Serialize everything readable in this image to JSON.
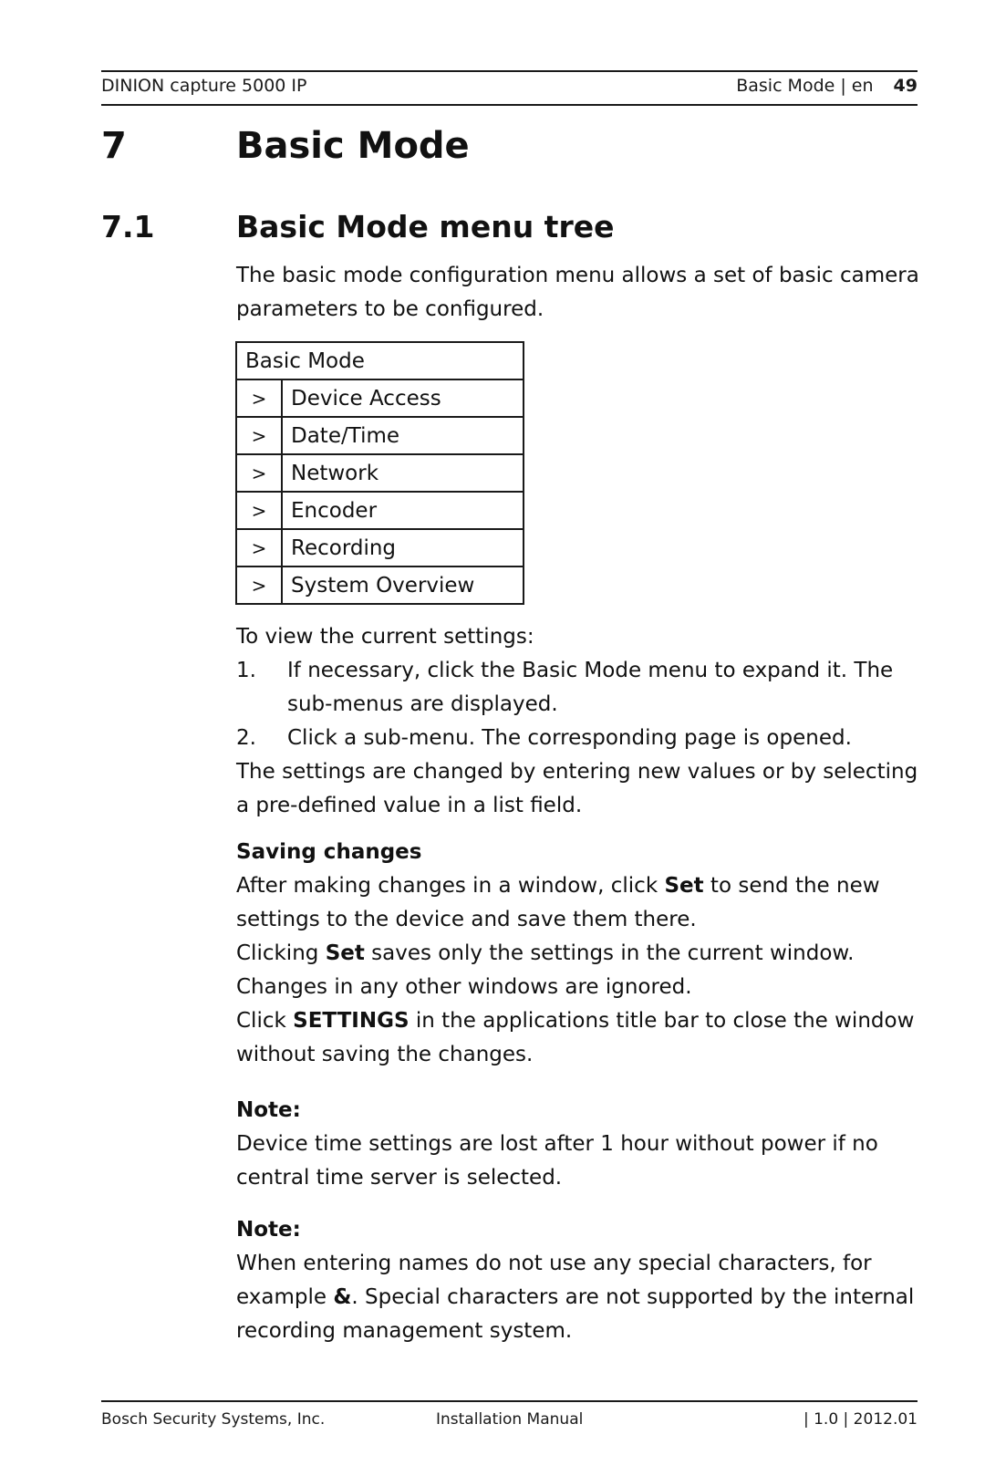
{
  "header": {
    "product": "DINION capture 5000 IP",
    "section": "Basic Mode | en",
    "page_number": "49"
  },
  "chapter": {
    "number": "7",
    "title": "Basic Mode"
  },
  "section": {
    "number": "7.1",
    "title": "Basic Mode menu tree",
    "intro": "The basic mode configuration menu allows a set of basic camera parameters to be configured."
  },
  "menu_tree": {
    "title": "Basic Mode",
    "arrow_glyph": ">",
    "items": [
      {
        "label": "Device Access"
      },
      {
        "label": "Date/Time"
      },
      {
        "label": "Network"
      },
      {
        "label": "Encoder"
      },
      {
        "label": "Recording"
      },
      {
        "label": "System Overview"
      }
    ]
  },
  "instructions": {
    "lead": "To view the current settings:",
    "steps": [
      {
        "num": "1.",
        "text": "If necessary, click the Basic Mode menu to expand it. The sub-menus are displayed."
      },
      {
        "num": "2.",
        "text": "Click a sub-menu. The corresponding page is opened."
      }
    ],
    "closing": "The settings are changed by entering new values or by selecting a pre-defined value in a list field."
  },
  "saving_changes": {
    "heading": "Saving changes",
    "p1_before": "After making changes in a window, click ",
    "p1_bold": "Set",
    "p1_after": " to send the new settings to the device and save them there.",
    "p2_before": "Clicking ",
    "p2_bold": "Set",
    "p2_after": " saves only the settings in the current window. Changes in any other windows are ignored.",
    "p3_before": "Click ",
    "p3_bold": "SETTINGS",
    "p3_after": " in the applications title bar to close the window without saving the changes."
  },
  "notes": [
    {
      "heading": "Note:",
      "text": "Device time settings are lost after 1 hour without power if no central time server is selected."
    },
    {
      "heading": "Note:",
      "text_before": "When entering names do not use any special characters, for example ",
      "text_bold": "&",
      "text_after": ". Special characters are not supported by the internal recording management system."
    }
  ],
  "footer": {
    "company": "Bosch Security Systems, Inc.",
    "document": "Installation Manual",
    "version_date": "| 1.0 | 2012.01"
  }
}
